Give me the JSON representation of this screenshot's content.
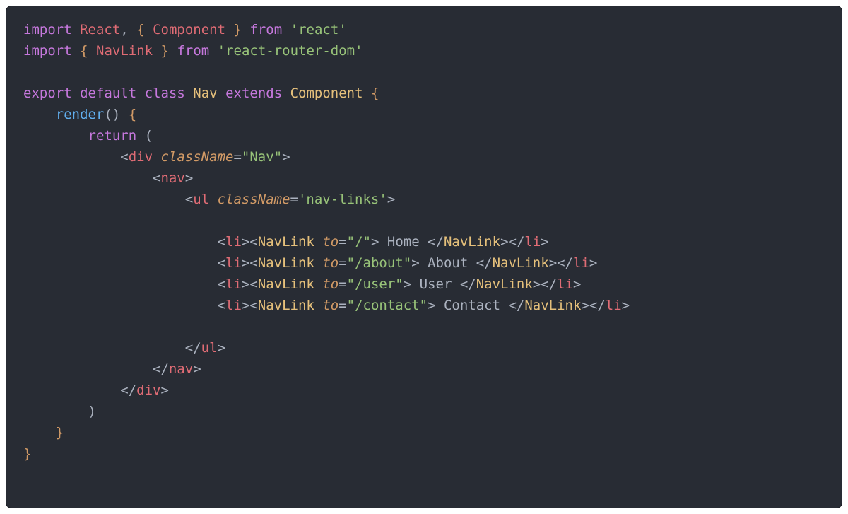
{
  "code": {
    "line1": {
      "import": "import",
      "react": "React",
      "comma": ",",
      "lbrace": "{",
      "component": "Component",
      "rbrace": "}",
      "from": "from",
      "module": "'react'"
    },
    "line2": {
      "import": "import",
      "lbrace": "{",
      "navlink": "NavLink",
      "rbrace": "}",
      "from": "from",
      "module": "'react-router-dom'"
    },
    "line4": {
      "export": "export",
      "default": "default",
      "class": "class",
      "nav": "Nav",
      "extends": "extends",
      "component": "Component",
      "lbrace": "{"
    },
    "line5": {
      "render": "render",
      "parens": "()",
      "lbrace": "{"
    },
    "line6": {
      "return": "return",
      "lparen": "("
    },
    "line7": {
      "lt": "<",
      "div": "div",
      "attr": "className",
      "eq": "=",
      "val": "\"Nav\"",
      "gt": ">"
    },
    "line8": {
      "lt": "<",
      "nav": "nav",
      "gt": ">"
    },
    "line9": {
      "lt": "<",
      "ul": "ul",
      "attr": "className",
      "eq": "=",
      "val": "'nav-links'",
      "gt": ">"
    },
    "navitems": [
      {
        "to": "\"/\"",
        "text": " Home "
      },
      {
        "to": "\"/about\"",
        "text": " About "
      },
      {
        "to": "\"/user\"",
        "text": " User "
      },
      {
        "to": "\"/contact\"",
        "text": " Contact "
      }
    ],
    "tags": {
      "li": "li",
      "NavLink": "NavLink",
      "to": "to",
      "ul_close": "ul",
      "nav_close": "nav",
      "div_close": "div"
    },
    "line15": {
      "lt": "</",
      "ul": "ul",
      "gt": ">"
    },
    "line16": {
      "lt": "</",
      "nav": "nav",
      "gt": ">"
    },
    "line17": {
      "lt": "</",
      "div": "div",
      "gt": ">"
    },
    "line18": {
      "rparen": ")"
    },
    "line19": {
      "rbrace": "}"
    },
    "line20": {
      "rbrace": "}"
    }
  }
}
